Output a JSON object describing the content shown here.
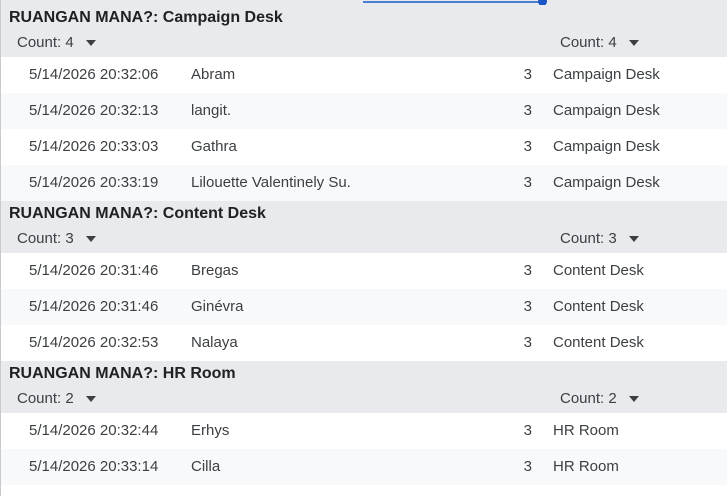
{
  "groups": [
    {
      "title": "RUANGAN MANA?: Campaign Desk",
      "count_left": "Count: 4",
      "count_right": "Count: 4",
      "rows": [
        {
          "timestamp": "5/14/2026 20:32:06",
          "name": "Abram",
          "value": "3",
          "room": "Campaign Desk"
        },
        {
          "timestamp": "5/14/2026 20:32:13",
          "name": "langit.",
          "value": "3",
          "room": "Campaign Desk"
        },
        {
          "timestamp": "5/14/2026 20:33:03",
          "name": "Gathra",
          "value": "3",
          "room": "Campaign Desk"
        },
        {
          "timestamp": "5/14/2026 20:33:19",
          "name": "Lilouette Valentinely Su.",
          "value": "3",
          "room": "Campaign Desk"
        }
      ]
    },
    {
      "title": "RUANGAN MANA?: Content Desk",
      "count_left": "Count: 3",
      "count_right": "Count: 3",
      "rows": [
        {
          "timestamp": "5/14/2026 20:31:46",
          "name": "Bregas",
          "value": "3",
          "room": "Content Desk"
        },
        {
          "timestamp": "5/14/2026 20:31:46",
          "name": "Ginévra",
          "value": "3",
          "room": "Content Desk"
        },
        {
          "timestamp": "5/14/2026 20:32:53",
          "name": "Nalaya",
          "value": "3",
          "room": "Content Desk"
        }
      ]
    },
    {
      "title": "RUANGAN MANA?: HR Room",
      "count_left": "Count: 2",
      "count_right": "Count: 2",
      "rows": [
        {
          "timestamp": "5/14/2026 20:32:44",
          "name": "Erhys",
          "value": "3",
          "room": "HR Room"
        },
        {
          "timestamp": "5/14/2026 20:33:14",
          "name": "Cilla",
          "value": "3",
          "room": "HR Room"
        }
      ]
    }
  ],
  "icons": {
    "count_dropdown": "chevron-down-icon"
  },
  "colors": {
    "header_bg": "#e8eaed",
    "row_alt_bg": "#f8f9fa",
    "selection_accent": "#1a56c8"
  }
}
